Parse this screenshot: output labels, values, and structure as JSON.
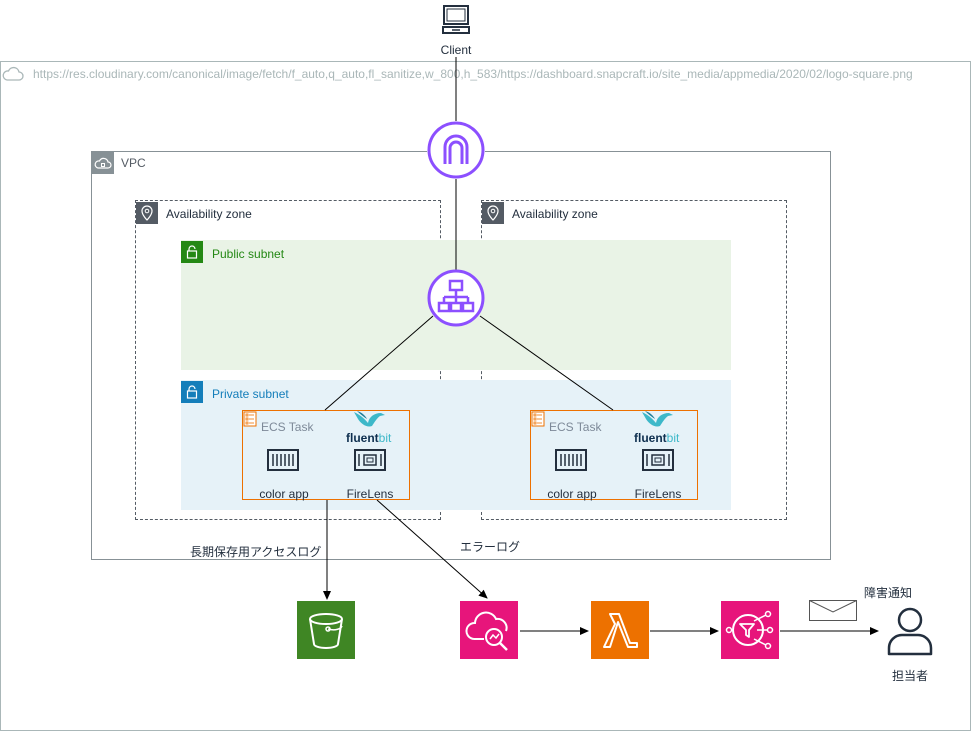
{
  "client": {
    "label": "Client"
  },
  "cloud": {
    "label": "https://res.cloudinary.com/canonical/image/fetch/f_auto,q_auto,fl_sanitize,w_800,h_583/https://dashboard.snapcraft.io/site_media/appmedia/2020/02/logo-square.png"
  },
  "vpc": {
    "label": "VPC"
  },
  "zones": [
    {
      "label": "Availability zone"
    },
    {
      "label": "Availability zone"
    }
  ],
  "subnets": {
    "public": {
      "label": "Public subnet"
    },
    "private": {
      "label": "Private subnet"
    }
  },
  "tasks": [
    {
      "title": "ECS Task",
      "logo": "fluentbit",
      "app": "color app",
      "sidecar": "FireLens"
    },
    {
      "title": "ECS Task",
      "logo": "fluentbit",
      "app": "color app",
      "sidecar": "FireLens"
    }
  ],
  "flows": {
    "access_log": "長期保存用アクセスログ",
    "error_log": "エラーログ",
    "notify": "障害通知"
  },
  "person": {
    "label": "担当者"
  },
  "colors": {
    "network": "#8C4FFF",
    "storage": "#3F8624",
    "management": "#E7157B",
    "compute": "#ED7100",
    "public_subnet": "#248814",
    "private_subnet": "#147EBA"
  },
  "icons": [
    "laptop-icon",
    "cloud-icon",
    "vpc-icon",
    "location-pin-icon",
    "lock-icon",
    "internet-gateway-icon",
    "load-balancer-icon",
    "task-icon",
    "container-icon",
    "s3-bucket-icon",
    "cloudwatch-logs-icon",
    "lambda-icon",
    "sns-icon",
    "envelope-icon",
    "user-icon",
    "hummingbird-icon"
  ]
}
